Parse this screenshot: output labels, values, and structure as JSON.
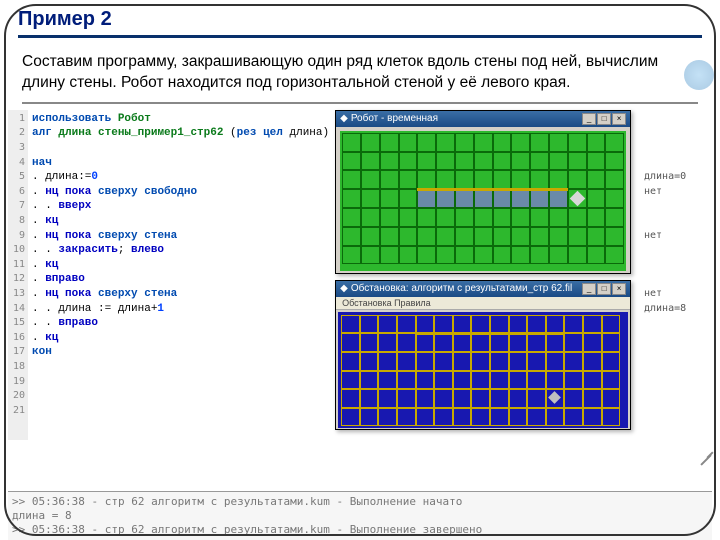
{
  "header": {
    "title": "Пример 2"
  },
  "description": "Составим программу, закрашивающую один ряд клеток вдоль стены под ней, вычислим длину стены. Робот находится под горизонтальной стеной у её левого края.",
  "code_lines": [
    {
      "n": "1",
      "html": "<span class='kw'>использовать</span> <span class='id'>Робот</span>"
    },
    {
      "n": "2",
      "html": "<span class='kw'>алг</span> <span class='id'>длина стены_пример1_стр62</span> (<span class='kw'>рез</span> <span class='kw'>цел</span> длина)"
    },
    {
      "n": "3",
      "html": ""
    },
    {
      "n": "4",
      "html": "<span class='kw'>нач</span>"
    },
    {
      "n": "5",
      "html": ". длина:=<span class='num'>0</span>"
    },
    {
      "n": "6",
      "html": ". <span class='kw2'>нц пока</span> <span class='kw'>сверху свободно</span>"
    },
    {
      "n": "7",
      "html": ". . <span class='kw2'>вверх</span>"
    },
    {
      "n": "8",
      "html": ". <span class='kw2'>кц</span>"
    },
    {
      "n": "9",
      "html": ". <span class='kw2'>нц пока</span> <span class='kw'>сверху стена</span>"
    },
    {
      "n": "10",
      "html": ". . <span class='kw2'>закрасить</span>; <span class='kw2'>влево</span>"
    },
    {
      "n": "11",
      "html": ". <span class='kw2'>кц</span>"
    },
    {
      "n": "12",
      "html": ". <span class='kw2'>вправо</span>"
    },
    {
      "n": "13",
      "html": ". <span class='kw2'>нц пока</span> <span class='kw'>сверху стена</span>"
    },
    {
      "n": "14",
      "html": ". . длина := длина+<span class='num'>1</span>"
    },
    {
      "n": "15",
      "html": ". . <span class='kw2'>вправо</span>"
    },
    {
      "n": "16",
      "html": ". <span class='kw2'>кц</span>"
    },
    {
      "n": "17",
      "html": "<span class='kw'>кон</span>"
    },
    {
      "n": "18",
      "html": ""
    },
    {
      "n": "19",
      "html": ""
    },
    {
      "n": "20",
      "html": ""
    },
    {
      "n": "21",
      "html": ""
    }
  ],
  "right_col": [
    "",
    "",
    "",
    "",
    "длина=0",
    "нет",
    "",
    "",
    "нет",
    "",
    "",
    "",
    "нет",
    "длина=8",
    "",
    "",
    ""
  ],
  "robot_win": {
    "title": "Робот - временная"
  },
  "env_win": {
    "title": "Обстановка: алгоритм с результатами_стр 62.fil",
    "menu": "Обстановка  Правила"
  },
  "console": [
    ">> 05:36:38 - стр 62 алгоритм с результатами.kum - Выполнение начато",
    "длина = 8",
    ">> 05:36:38 - стр 62 алгоритм с результатами.kum - Выполнение завершено"
  ]
}
